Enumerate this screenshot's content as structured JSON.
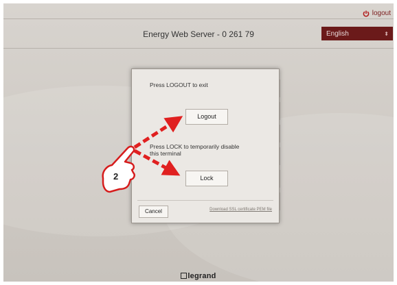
{
  "header": {
    "logout_label": "logout",
    "server_title": "Energy Web Server - 0 261 79",
    "language": "English"
  },
  "dialog": {
    "logout_prompt": "Press LOGOUT to exit",
    "logout_button": "Logout",
    "lock_prompt_line1": "Press LOCK to temporarily disable",
    "lock_prompt_line2": "this terminal",
    "lock_button": "Lock",
    "cancel_button": "Cancel",
    "download_link": "Download SSL certificate PEM file"
  },
  "annotation": {
    "step_number": "2",
    "icons": [
      "pointing-hand-icon",
      "red-dashed-arrow"
    ]
  },
  "footer": {
    "brand": "legrand"
  },
  "colors": {
    "background": "#d4d0cb",
    "accent": "#6b1a1a",
    "arrow": "#e02020"
  }
}
